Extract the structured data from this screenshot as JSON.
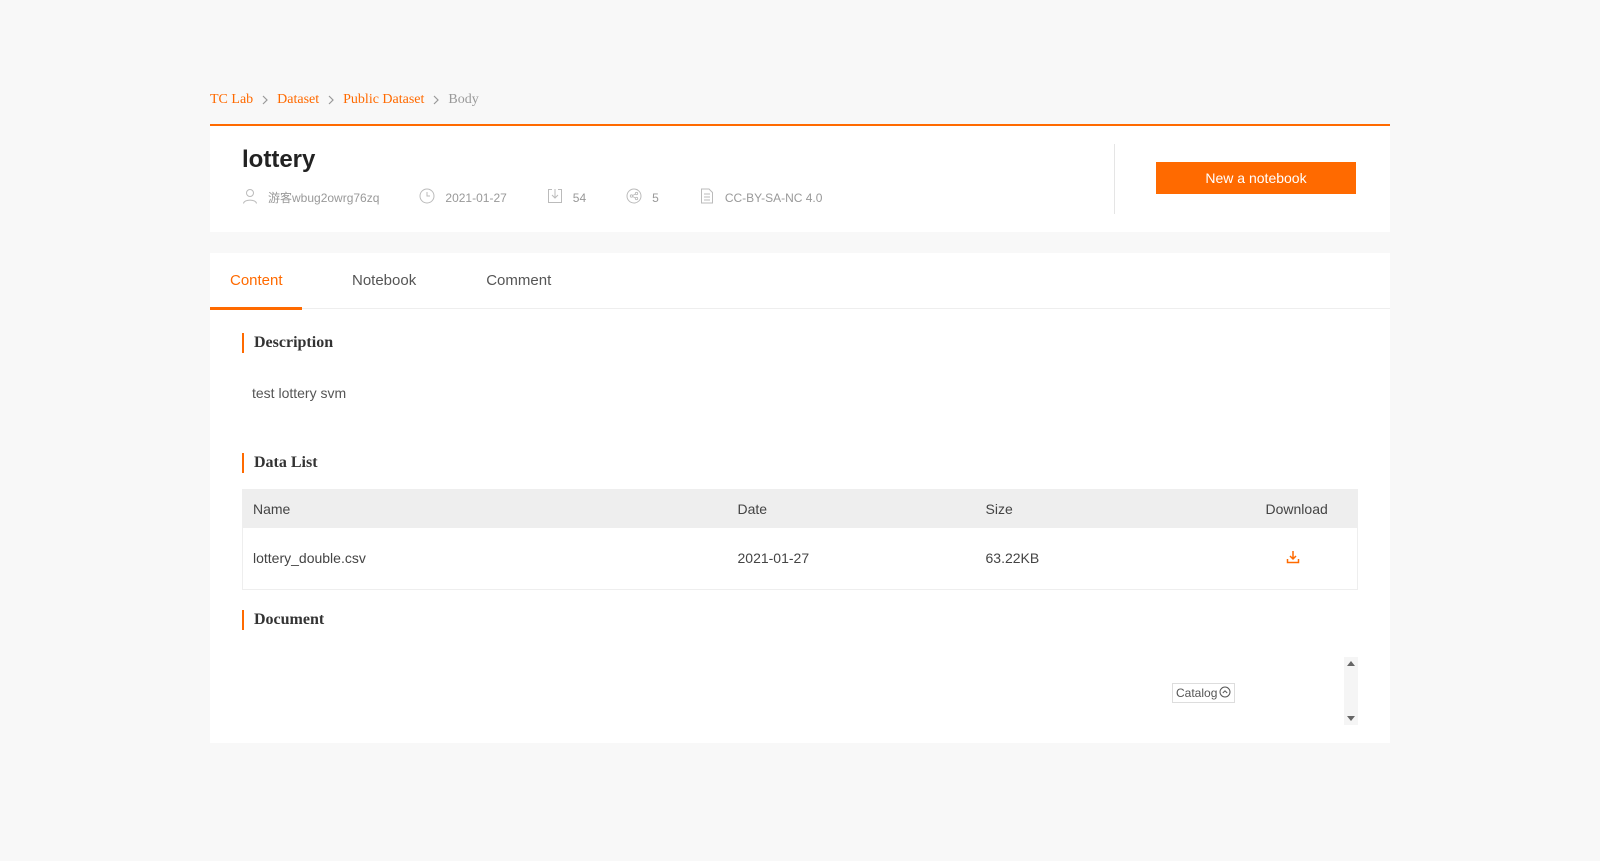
{
  "breadcrumb": {
    "items": [
      "TC Lab",
      "Dataset",
      "Public Dataset"
    ],
    "current": "Body"
  },
  "dataset": {
    "title": "lottery",
    "author": "游客wbug2owrg76zq",
    "date": "2021-01-27",
    "downloads": "54",
    "shares": "5",
    "license": "CC-BY-SA-NC 4.0",
    "new_notebook_label": "New a notebook"
  },
  "tabs": [
    {
      "label": "Content",
      "active": true
    },
    {
      "label": "Notebook",
      "active": false
    },
    {
      "label": "Comment",
      "active": false
    }
  ],
  "description": {
    "heading": "Description",
    "text": "test lottery svm"
  },
  "data_list": {
    "heading": "Data List",
    "columns": [
      "Name",
      "Date",
      "Size",
      "Download"
    ],
    "rows": [
      {
        "name": "lottery_double.csv",
        "date": "2021-01-27",
        "size": "63.22KB",
        "download_icon": "download-icon"
      }
    ]
  },
  "document": {
    "heading": "Document",
    "catalog_label": "Catalog"
  },
  "colors": {
    "accent": "#ff6a00",
    "background": "#f8f8f8"
  }
}
